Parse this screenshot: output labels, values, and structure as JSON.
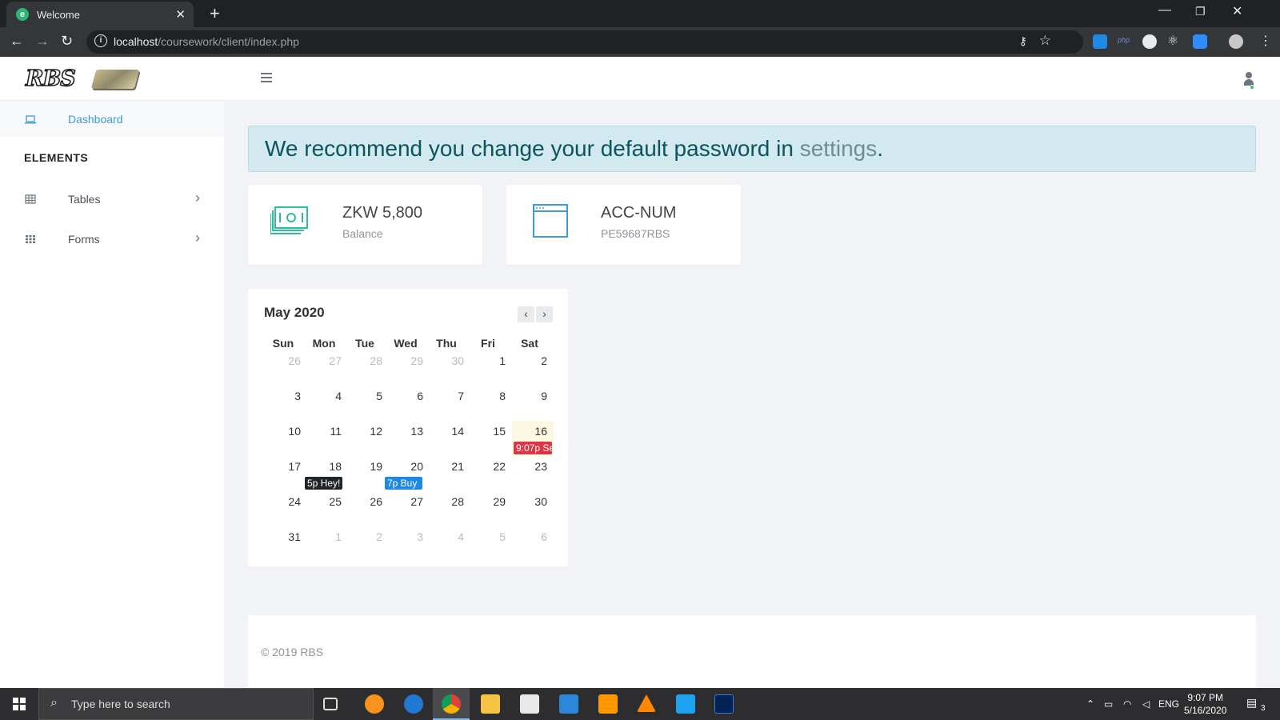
{
  "browser": {
    "tab_title": "Welcome",
    "tab_favicon": "e",
    "url_host": "localhost",
    "url_path": "/coursework/client/index.php"
  },
  "header": {
    "logo_text": "RBS"
  },
  "sidebar": {
    "items": [
      {
        "label": "Dashboard",
        "icon": "laptop-icon"
      },
      {
        "label": "Tables",
        "icon": "table-icon"
      },
      {
        "label": "Forms",
        "icon": "grid-icon"
      }
    ],
    "heading": "ELEMENTS"
  },
  "alert": {
    "text": "We recommend you change your default password in ",
    "link": "settings",
    "suffix": "."
  },
  "cards": {
    "balance": {
      "value": "ZKW 5,800",
      "label": "Balance"
    },
    "account": {
      "value": "ACC-NUM",
      "label": "PE59687RBS"
    }
  },
  "calendar": {
    "title": "May 2020",
    "prev": "‹",
    "next": "›",
    "weekdays": [
      "Sun",
      "Mon",
      "Tue",
      "Wed",
      "Thu",
      "Fri",
      "Sat"
    ],
    "weeks": [
      [
        "26",
        "27",
        "28",
        "29",
        "30",
        "1",
        "2"
      ],
      [
        "3",
        "4",
        "5",
        "6",
        "7",
        "8",
        "9"
      ],
      [
        "10",
        "11",
        "12",
        "13",
        "14",
        "15",
        "16"
      ],
      [
        "17",
        "18",
        "19",
        "20",
        "21",
        "22",
        "23"
      ],
      [
        "24",
        "25",
        "26",
        "27",
        "28",
        "29",
        "30"
      ],
      [
        "31",
        "1",
        "2",
        "3",
        "4",
        "5",
        "6"
      ]
    ],
    "events": [
      {
        "label": "9:07p Se",
        "color": "#dc3545"
      },
      {
        "label": "5p Hey!",
        "color": "#212529"
      },
      {
        "label": "7p Buy",
        "color": "#1e88e5"
      }
    ]
  },
  "footer": {
    "copyright": "© 2019 RBS"
  },
  "taskbar": {
    "search_placeholder": "Type here to search",
    "lang": "ENG",
    "time": "9:07 PM",
    "date": "5/16/2020",
    "notifications": "3"
  }
}
